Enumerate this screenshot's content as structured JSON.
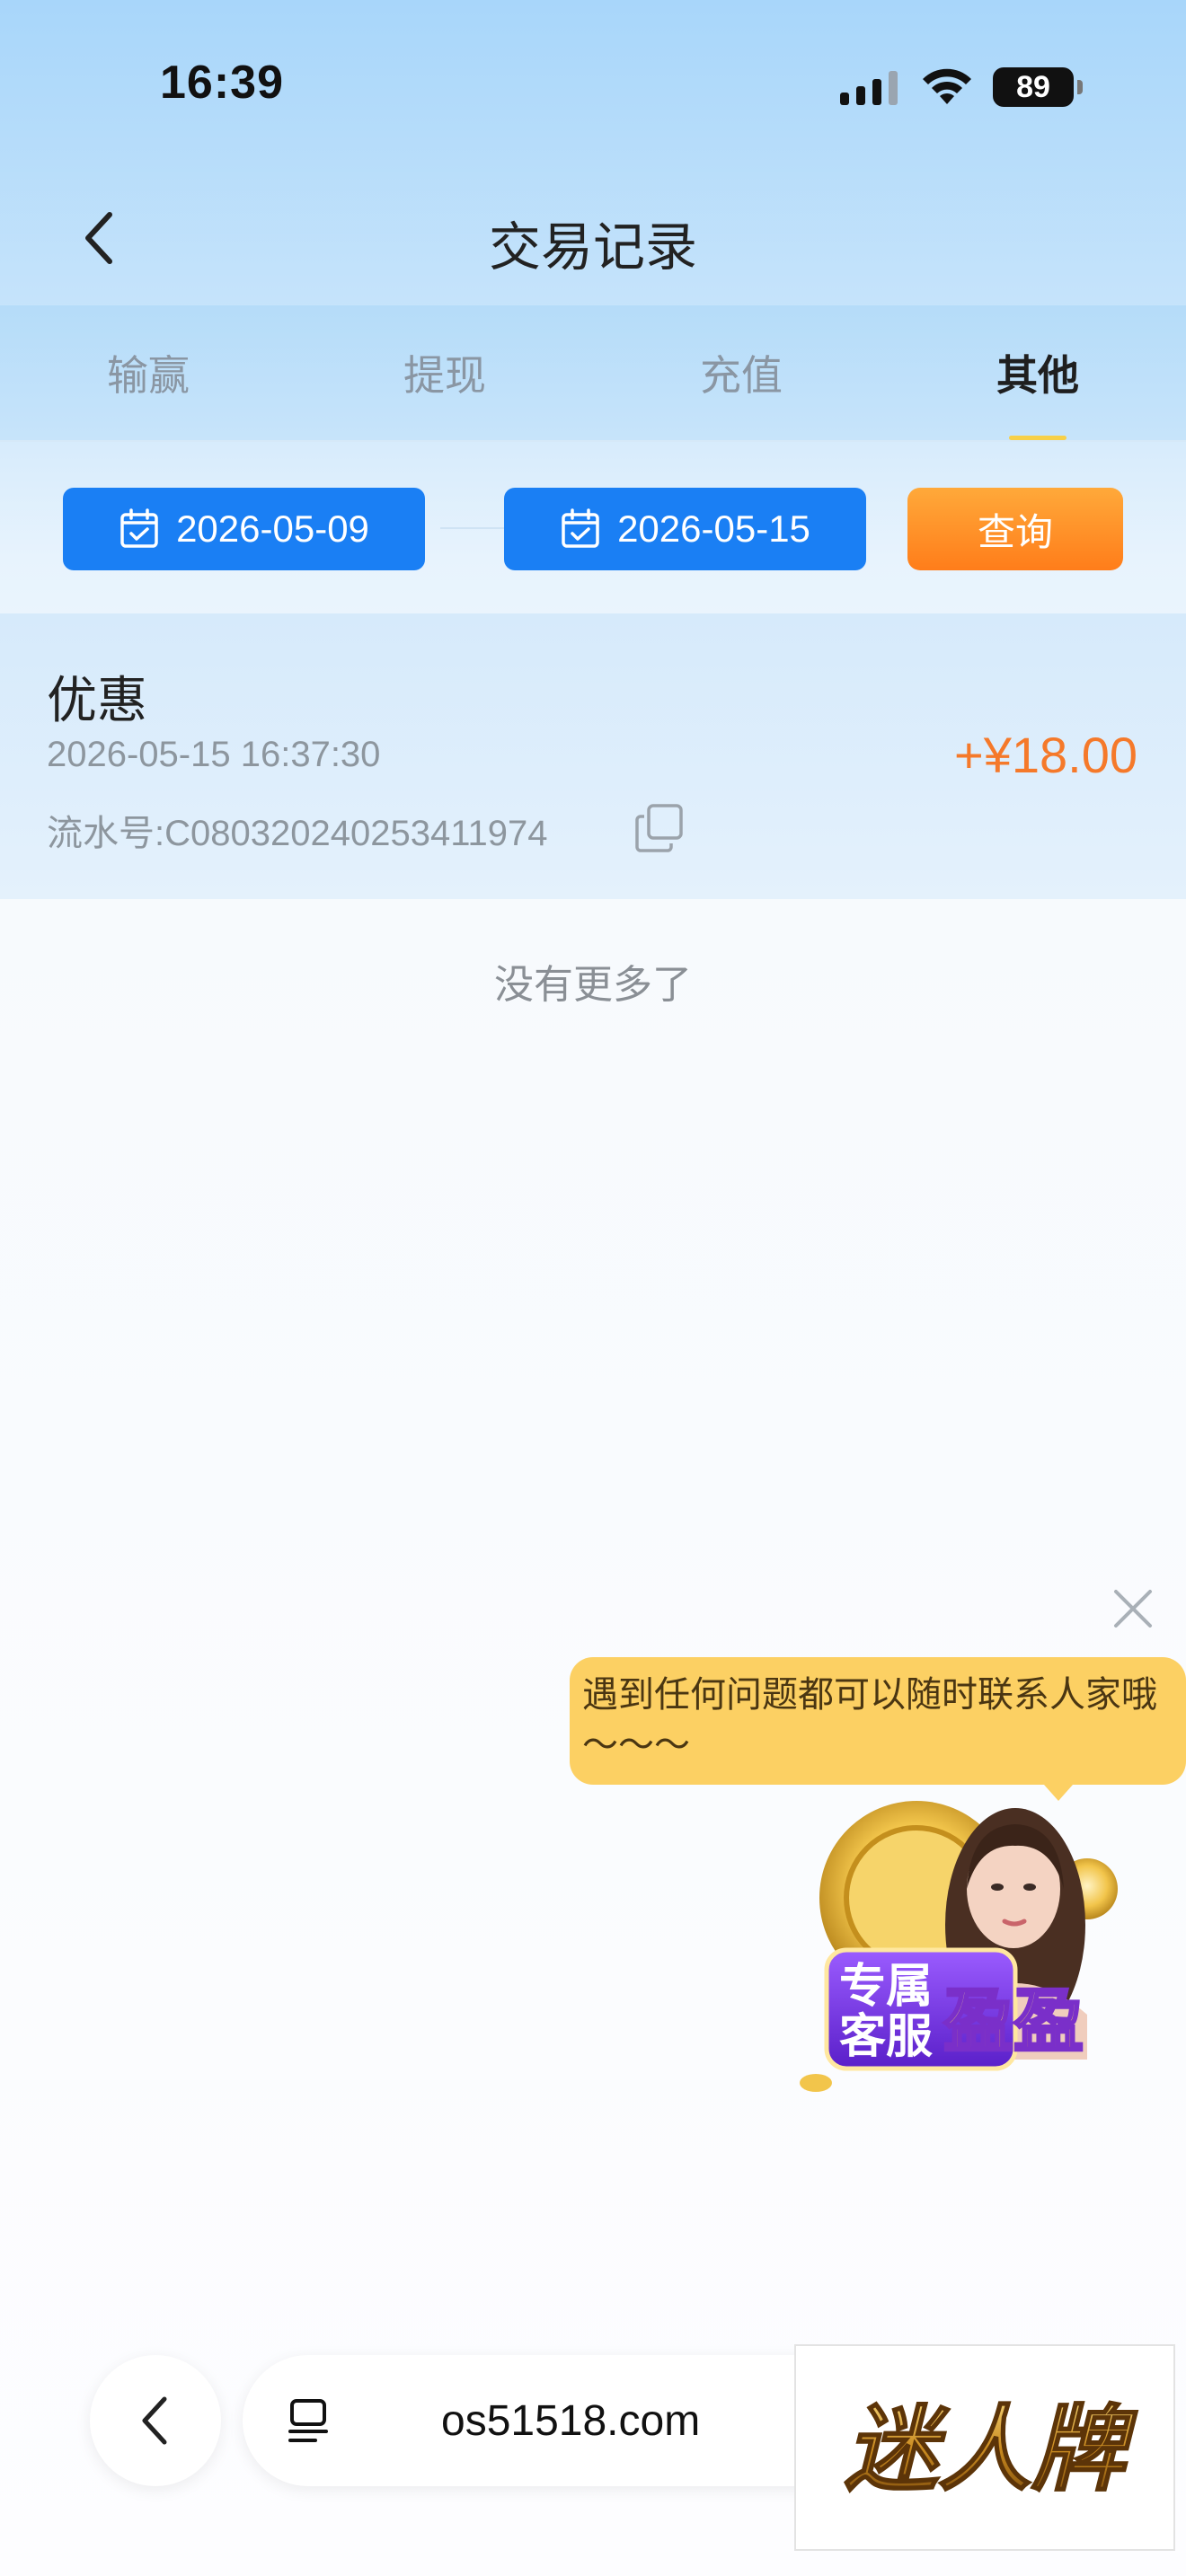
{
  "status_bar": {
    "time": "16:39",
    "battery": "89",
    "icons": [
      "signal-icon",
      "wifi-icon",
      "battery-icon"
    ]
  },
  "header": {
    "title": "交易记录",
    "back_icon": "chevron-left-icon"
  },
  "tabs": [
    {
      "label": "输赢",
      "active": false
    },
    {
      "label": "提现",
      "active": false
    },
    {
      "label": "充值",
      "active": false
    },
    {
      "label": "其他",
      "active": true
    }
  ],
  "filter": {
    "start_date": "2026-05-09",
    "end_date": "2026-05-15",
    "query_label": "查询",
    "date_icon": "calendar-check-icon"
  },
  "records": [
    {
      "title": "优惠",
      "time": "2026-05-15 16:37:30",
      "serial": "流水号:C080320240253411974",
      "amount": "+¥18.00",
      "copy_icon": "copy-icon"
    }
  ],
  "list_end_text": "没有更多了",
  "support_popup": {
    "message": "遇到任何问题都可以随时联系人家哦～～～",
    "badge_line1": "专属",
    "badge_line2": "客服",
    "badge_name": "盈盈",
    "close_icon": "close-icon"
  },
  "browser_bar": {
    "url": "os51518.com",
    "back_icon": "chevron-left-icon",
    "tabs_icon": "page-tabs-icon"
  },
  "brand": {
    "logo_text": "迷人牌"
  },
  "colors": {
    "primary": "#1a7ff4",
    "accent_orange": "#ff8a24",
    "amount": "#f5792a",
    "bubble": "#fcd063"
  }
}
